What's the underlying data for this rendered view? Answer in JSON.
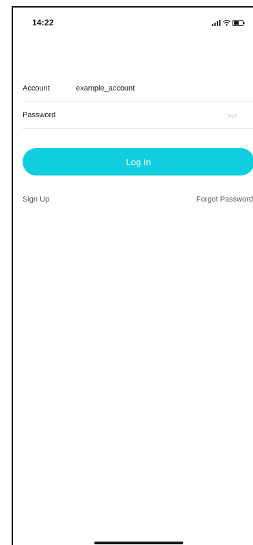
{
  "status_bar": {
    "time": "14:22",
    "icons": [
      "signal-icon",
      "wifi-icon",
      "battery-icon"
    ]
  },
  "form": {
    "account_label": "Account",
    "account_value": "example_account",
    "password_label": "Password",
    "password_value": "",
    "password_toggle_icon": "eye-closed-icon"
  },
  "actions": {
    "login_label": "Log In",
    "signup_label": "Sign Up",
    "forgot_label": "Forgot Password"
  },
  "colors": {
    "accent": "#10cee0",
    "text": "#222222",
    "muted": "#555555",
    "divider": "#ececec"
  }
}
